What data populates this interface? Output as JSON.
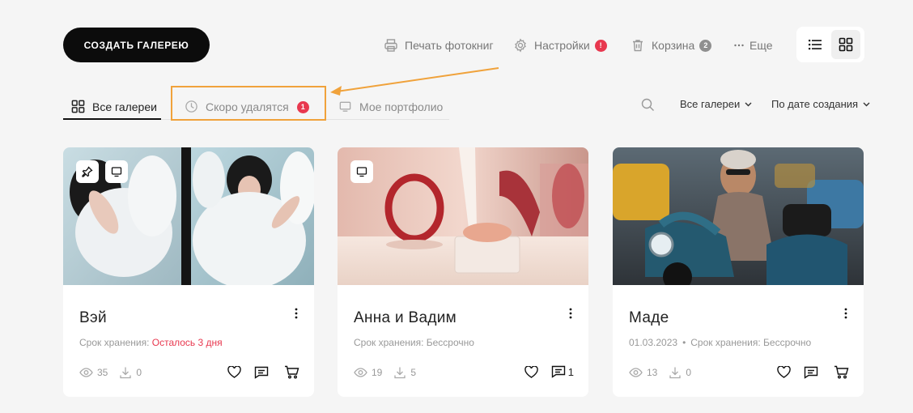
{
  "header": {
    "create_button": "СОЗДАТЬ ГАЛЕРЕЮ",
    "nav": {
      "print": "Печать фотокниг",
      "settings": "Настройки",
      "settings_badge": "!",
      "trash": "Корзина",
      "trash_badge": "2",
      "more": "Еще"
    }
  },
  "tabs": {
    "all": "Все галереи",
    "soon_deleted": "Скоро удалятся",
    "soon_deleted_badge": "1",
    "portfolio": "Мое портфолио"
  },
  "filters": {
    "scope": "Все галереи",
    "sort": "По дате создания"
  },
  "galleries": [
    {
      "title": "Вэй",
      "meta_prefix": "Срок хранения: ",
      "meta_value": "Осталось 3 дня",
      "views": "35",
      "downloads": "0",
      "comments": ""
    },
    {
      "title": "Анна и Вадим",
      "meta_prefix": "Срок хранения: ",
      "meta_value": "Бессрочно",
      "views": "19",
      "downloads": "5",
      "comments": "1"
    },
    {
      "title": "Маде",
      "date": "01.03.2023",
      "meta_prefix": "Срок хранения: ",
      "meta_value": "Бессрочно",
      "views": "13",
      "downloads": "0",
      "comments": ""
    }
  ],
  "colors": {
    "accent": "#0c0c0c",
    "badge_red": "#e8384f",
    "highlight": "#f0a23b"
  }
}
